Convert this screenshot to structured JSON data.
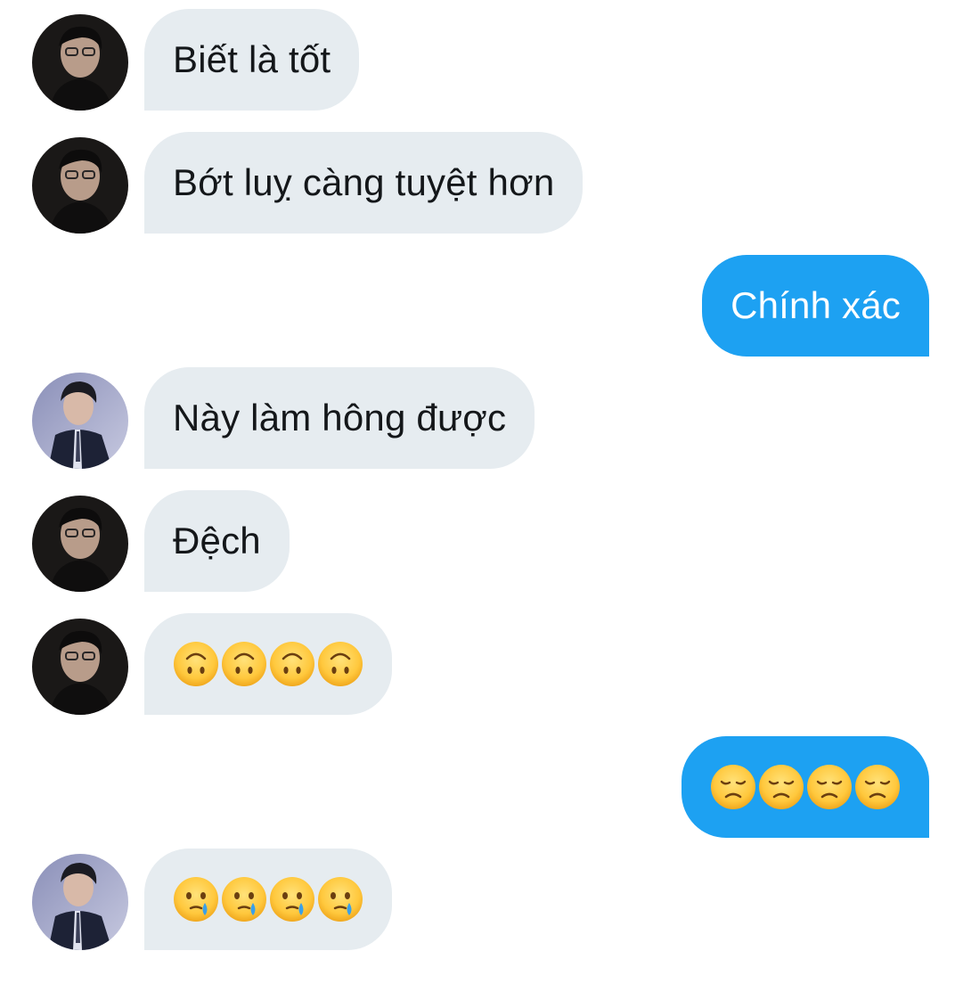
{
  "messages": [
    {
      "direction": "in",
      "avatar": "avatar-dark-glasses",
      "text": "Biết là tốt"
    },
    {
      "direction": "in",
      "avatar": "avatar-dark-glasses",
      "text": "Bớt luỵ càng tuyệt hơn"
    },
    {
      "direction": "out",
      "text": "Chính xác"
    },
    {
      "direction": "in",
      "avatar": "avatar-suit",
      "text": "Này làm hông được"
    },
    {
      "direction": "in",
      "avatar": "avatar-dark-glasses",
      "text": "Đệch"
    },
    {
      "direction": "in",
      "avatar": "avatar-dark-glasses",
      "emoji": "upside-down-face",
      "emoji_count": 4
    },
    {
      "direction": "out",
      "emoji": "disappointed-face",
      "emoji_count": 4
    },
    {
      "direction": "in",
      "avatar": "avatar-suit",
      "emoji": "face-holding-back-tears",
      "emoji_count": 4
    }
  ],
  "colors": {
    "incoming_bubble": "#e6ecf0",
    "outgoing_bubble": "#1da1f2",
    "incoming_text": "#14171a",
    "outgoing_text": "#ffffff"
  }
}
